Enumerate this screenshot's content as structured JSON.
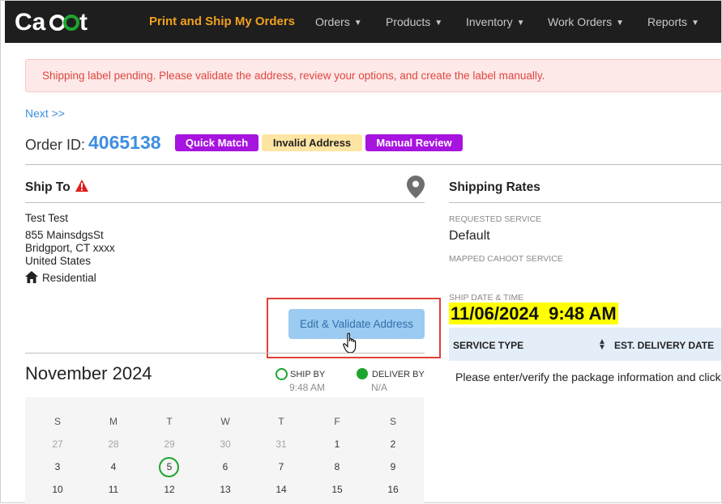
{
  "nav": {
    "logo_text": "Cahoot",
    "primary": "Print and Ship My Orders",
    "items": [
      "Orders",
      "Products",
      "Inventory",
      "Work Orders",
      "Reports"
    ]
  },
  "alert": "Shipping label pending. Please validate the address, review your options, and create the label manually.",
  "next_link": "Next >>",
  "order": {
    "label": "Order ID:",
    "id": "4065138",
    "badges": [
      "Quick Match",
      "Invalid Address",
      "Manual Review"
    ]
  },
  "ship_to": {
    "title": "Ship To",
    "name": "Test Test",
    "street": "855 MainsdgsSt",
    "city_line": "Bridgport, CT xxxx",
    "country": "United States",
    "type": "Residential",
    "edit_button": "Edit & Validate Address"
  },
  "calendar": {
    "month": "November 2024",
    "ship_by_label": "SHIP BY",
    "ship_by_value": "9:48 AM",
    "deliver_by_label": "DELIVER BY",
    "deliver_by_value": "N/A",
    "weekdays": [
      "S",
      "M",
      "T",
      "W",
      "T",
      "F",
      "S"
    ],
    "weeks": [
      [
        "27",
        "28",
        "29",
        "30",
        "31",
        "1",
        "2"
      ],
      [
        "3",
        "4",
        "5",
        "6",
        "7",
        "8",
        "9"
      ],
      [
        "10",
        "11",
        "12",
        "13",
        "14",
        "15",
        "16"
      ]
    ],
    "today": "5"
  },
  "rates": {
    "title": "Shipping Rates",
    "requested_label": "REQUESTED SERVICE",
    "requested_value": "Default",
    "mapped_label": "MAPPED CAHOOT SERVICE",
    "ship_date_label": "SHIP DATE & TIME",
    "ship_date_value": "11/06/2024  9:48 AM",
    "col_service": "SERVICE TYPE",
    "col_delivery": "EST. DELIVERY DATE",
    "message": "Please enter/verify the package information and click"
  },
  "colors": {
    "accent_blue": "#3f8ee0",
    "nav_bg": "#1e1e1e",
    "brand_orange": "#f0a020",
    "badge_purple": "#a713df",
    "badge_yellow": "#ffe5a3",
    "ship_green": "#1ea52e",
    "alert_red": "#e0463f"
  }
}
